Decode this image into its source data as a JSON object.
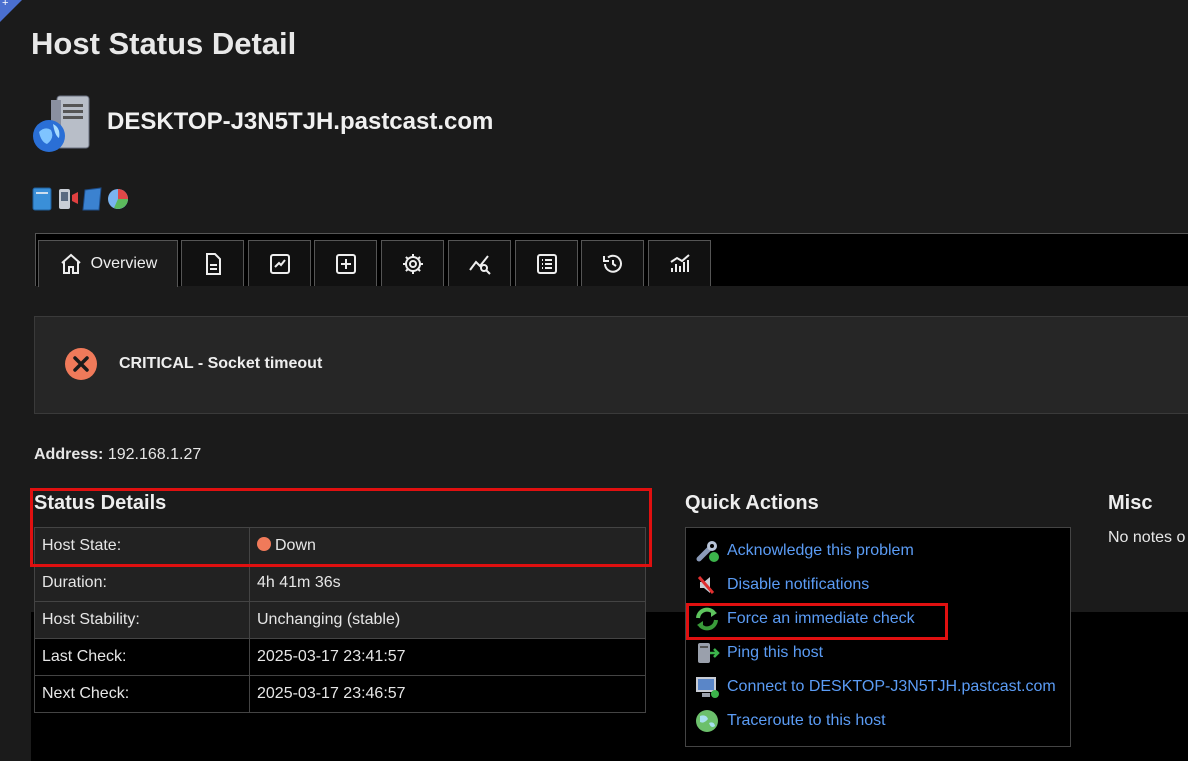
{
  "page": {
    "title": "Host Status Detail"
  },
  "host": {
    "name": "DESKTOP-J3N5TJH.pastcast.com"
  },
  "small_icons": [
    "notes-icon",
    "sms-icon",
    "book-icon",
    "pie-chart-icon"
  ],
  "tabs": [
    {
      "label": "Overview",
      "icon": "home-icon"
    },
    {
      "icon": "document-icon"
    },
    {
      "icon": "trend-chart-icon"
    },
    {
      "icon": "plus-square-icon"
    },
    {
      "icon": "gear-icon"
    },
    {
      "icon": "chart-search-icon"
    },
    {
      "icon": "list-icon"
    },
    {
      "icon": "history-icon"
    },
    {
      "icon": "bar-chart-icon"
    }
  ],
  "alert": {
    "status": "CRITICAL - Socket timeout",
    "icon": "critical-x-icon",
    "color": "#f07a5a"
  },
  "address": {
    "label": "Address:",
    "value": "192.168.1.27"
  },
  "status_details": {
    "title": "Status Details",
    "rows": [
      {
        "label": "Host State:",
        "value": "Down",
        "status_color": "#f07a5a"
      },
      {
        "label": "Duration:",
        "value": "4h 41m 36s"
      },
      {
        "label": "Host Stability:",
        "value": "Unchanging (stable)"
      },
      {
        "label": "Last Check:",
        "value": "2025-03-17 23:41:57"
      },
      {
        "label": "Next Check:",
        "value": "2025-03-17 23:46:57"
      }
    ]
  },
  "quick_actions": {
    "title": "Quick Actions",
    "items": [
      {
        "label": "Acknowledge this problem",
        "icon": "wrench-icon"
      },
      {
        "label": "Disable notifications",
        "icon": "notifications-off-icon"
      },
      {
        "label": "Force an immediate check",
        "icon": "refresh-icon"
      },
      {
        "label": "Ping this host",
        "icon": "ping-icon"
      },
      {
        "label": "Connect to DESKTOP-J3N5TJH.pastcast.com",
        "icon": "monitor-icon"
      },
      {
        "label": "Traceroute to this host",
        "icon": "globe-icon"
      }
    ]
  },
  "misc": {
    "title": "Misc",
    "note": "No notes o"
  },
  "colors": {
    "link": "#5b9cf5",
    "highlight": "#e01010"
  }
}
